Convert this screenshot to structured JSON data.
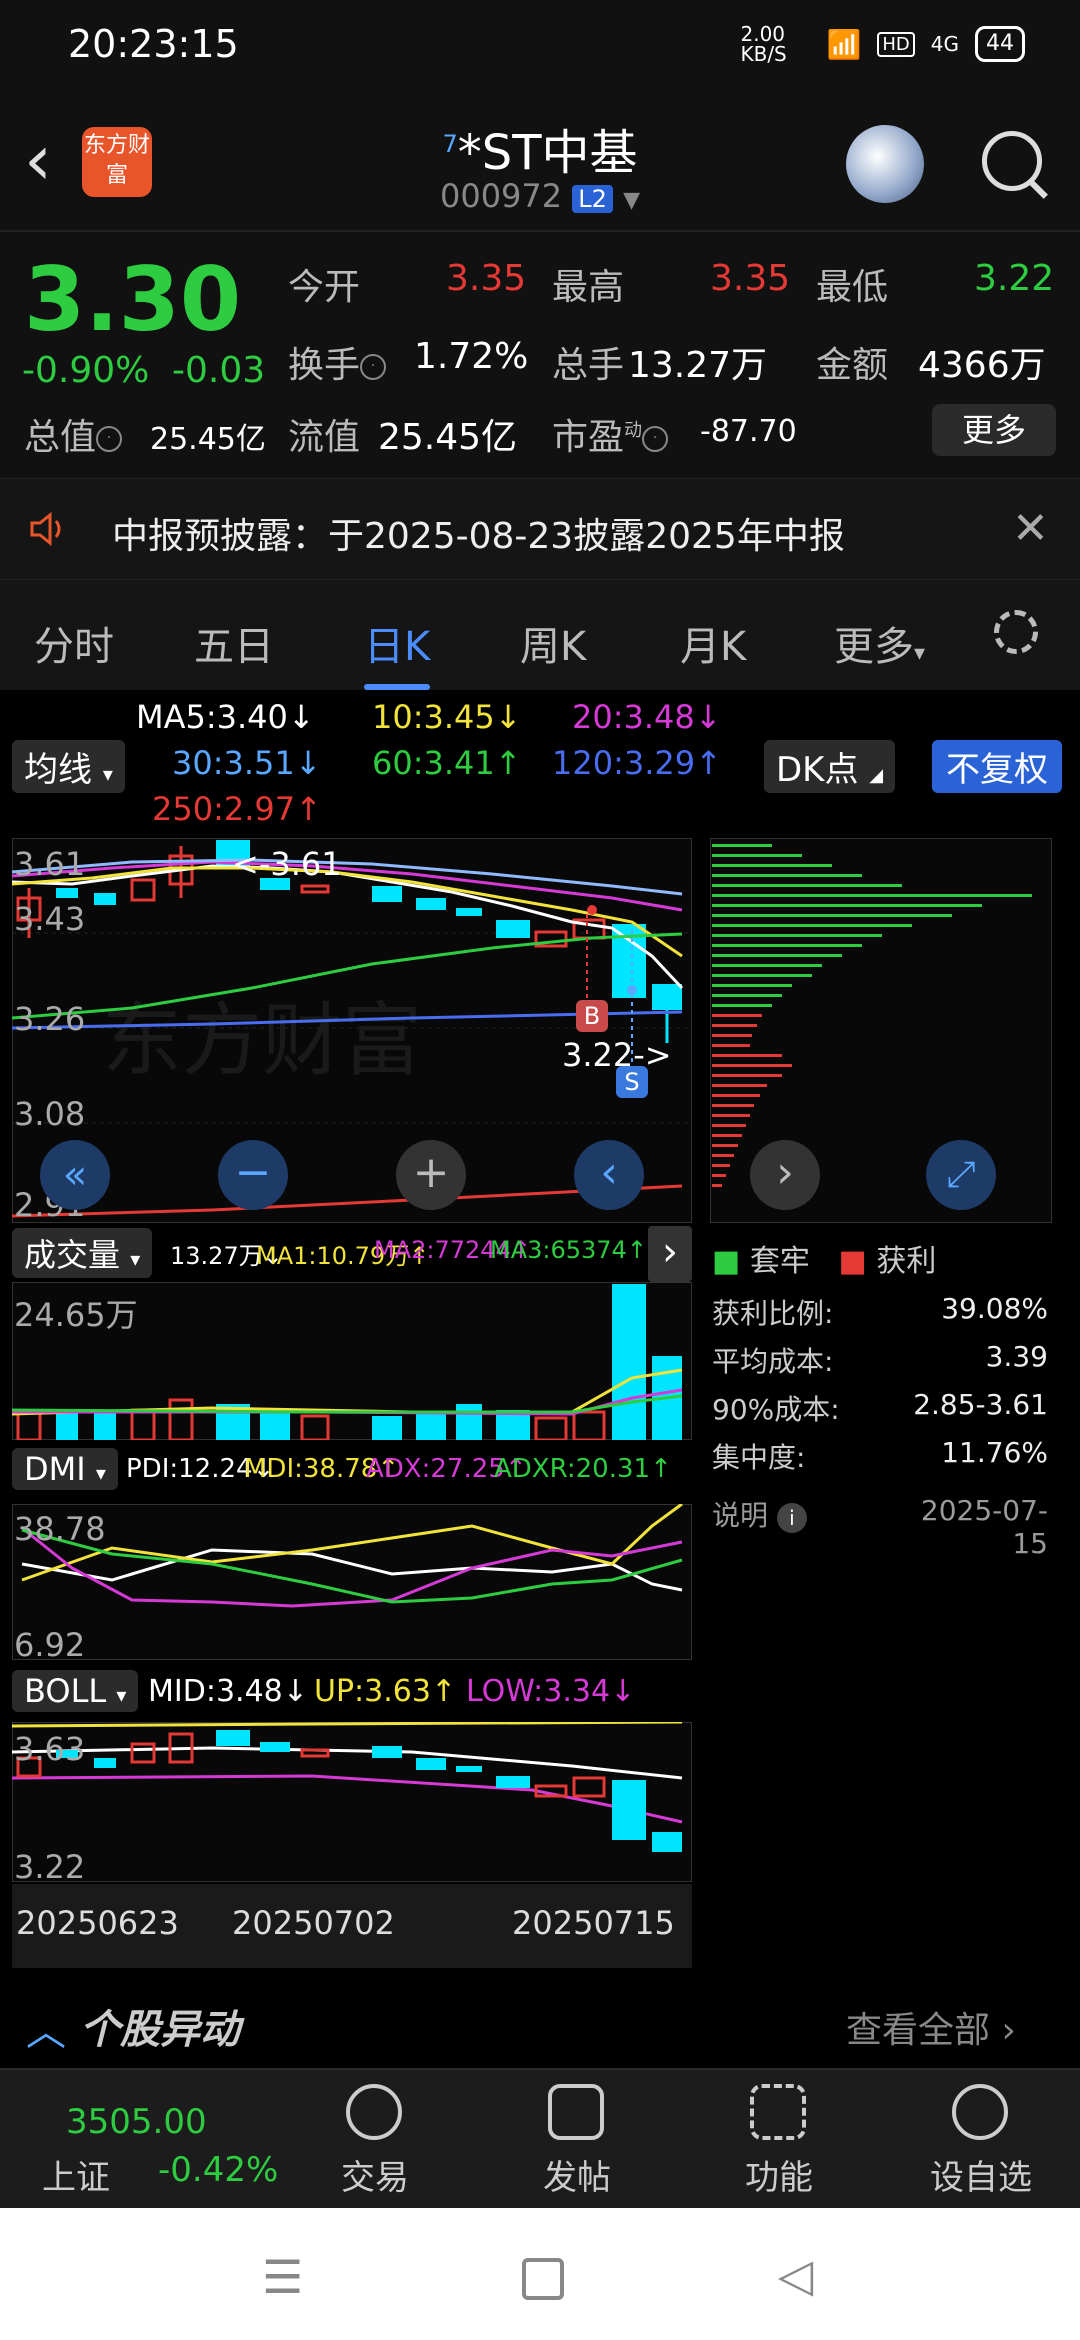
{
  "status": {
    "time": "20:23:15",
    "net_speed": "2.00 KB/S",
    "hd": "HD",
    "signal": "4G",
    "battery": "44"
  },
  "header": {
    "logo_text": "东方财富",
    "stock_name": "*ST中基",
    "stock_sup": "7",
    "stock_code": "000972",
    "level_badge": "L2"
  },
  "quote": {
    "price": "3.30",
    "change_pct": "-0.90%",
    "change_abs": "-0.03",
    "open_label": "今开",
    "open": "3.35",
    "high_label": "最高",
    "high": "3.35",
    "low_label": "最低",
    "low": "3.22",
    "turnover_label": "换手",
    "turnover": "1.72%",
    "volume_label": "总手",
    "volume": "13.27万",
    "amount_label": "金额",
    "amount": "4366万",
    "mktcap_label": "总值",
    "mktcap": "25.45亿",
    "float_label": "流值",
    "float": "25.45亿",
    "pe_label": "市盈",
    "pe_sup": "动",
    "pe": "-87.70",
    "more_label": "更多"
  },
  "notice": {
    "text": "中报预披露：于2025-08-23披露2025年中报"
  },
  "tabs": [
    "分时",
    "五日",
    "日K",
    "周K",
    "月K",
    "更多"
  ],
  "ma": {
    "selector": "均线",
    "ma5": "MA5:3.40",
    "ma10": "10:3.45",
    "ma20": "20:3.48",
    "ma30": "30:3.51",
    "ma60": "60:3.41",
    "ma120": "120:3.29",
    "ma250": "250:2.97",
    "dk_label": "DK点",
    "fq_label": "不复权"
  },
  "kline": {
    "y_ticks": [
      "3.61",
      "3.43",
      "3.26",
      "3.08",
      "2.91"
    ],
    "max_label": "<-3.61",
    "min_label": "3.22->",
    "buy_marker": "B",
    "sell_marker": "S"
  },
  "volume": {
    "selector": "成交量",
    "total": "13.27万",
    "ma1": "MA1:10.79万",
    "ma2": "MA2:77244",
    "ma3": "MA3:65374",
    "y_max": "24.65万"
  },
  "dmi": {
    "selector": "DMI",
    "pdi": "PDI:12.24",
    "mdi": "MDI:38.78",
    "adx": "ADX:27.25",
    "adxr": "ADXR:20.31",
    "y_top": "38.78",
    "y_bottom": "6.92"
  },
  "boll": {
    "selector": "BOLL",
    "mid": "MID:3.48",
    "up": "UP:3.63",
    "low": "LOW:3.34",
    "y_top": "3.63",
    "y_bottom": "3.22"
  },
  "dates": [
    "20250623",
    "20250702",
    "20250715"
  ],
  "chips": {
    "legend_trapped": "套牢",
    "legend_profit": "获利",
    "stats": [
      {
        "label": "获利比例:",
        "value": "39.08%"
      },
      {
        "label": "平均成本:",
        "value": "3.39"
      },
      {
        "label": "90%成本:",
        "value": "2.85-3.61"
      },
      {
        "label": "集中度:",
        "value": "11.76%"
      }
    ],
    "note_label": "说明",
    "date": "2025-07-15"
  },
  "movement": {
    "title": "个股异动",
    "view_all": "查看全部"
  },
  "bottom_nav": {
    "index_value": "3505.00",
    "index_name": "上证",
    "index_change": "-0.42%",
    "items": [
      "交易",
      "发帖",
      "功能",
      "设自选"
    ]
  },
  "colors": {
    "up": "#e53935",
    "down": "#2ecc40",
    "accent": "#4b8cff",
    "candle_down": "#00e5ff"
  }
}
